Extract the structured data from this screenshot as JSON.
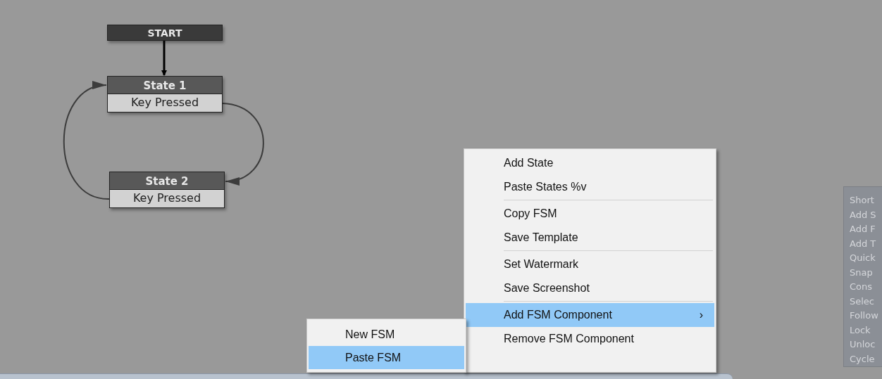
{
  "graph": {
    "nodes": [
      {
        "kind": "start",
        "title": "START"
      },
      {
        "kind": "state",
        "title": "State 1",
        "event": "Key Pressed"
      },
      {
        "kind": "state",
        "title": "State 2",
        "event": "Key Pressed"
      }
    ]
  },
  "context_menu": {
    "groups": [
      [
        {
          "label": "Add State",
          "selected": false
        },
        {
          "label": "Paste States %v",
          "selected": false
        }
      ],
      [
        {
          "label": "Copy FSM",
          "selected": false
        },
        {
          "label": "Save Template",
          "selected": false
        }
      ],
      [
        {
          "label": "Set Watermark",
          "selected": false
        },
        {
          "label": "Save Screenshot",
          "selected": false
        }
      ],
      [
        {
          "label": "Add FSM Component",
          "selected": true,
          "submenu_arrow": "›"
        },
        {
          "label": "Remove FSM Component",
          "selected": false
        }
      ]
    ]
  },
  "submenu": {
    "items": [
      {
        "label": "New FSM",
        "selected": false
      },
      {
        "label": "Paste FSM",
        "selected": true
      }
    ]
  },
  "shortcuts_panel": {
    "lines": [
      "Short",
      "Add S",
      "Add F",
      "Add T",
      "Quick",
      "Snap",
      "Cons",
      "Selec",
      "Follow",
      "Lock",
      "Unloc",
      "Cycle"
    ]
  }
}
